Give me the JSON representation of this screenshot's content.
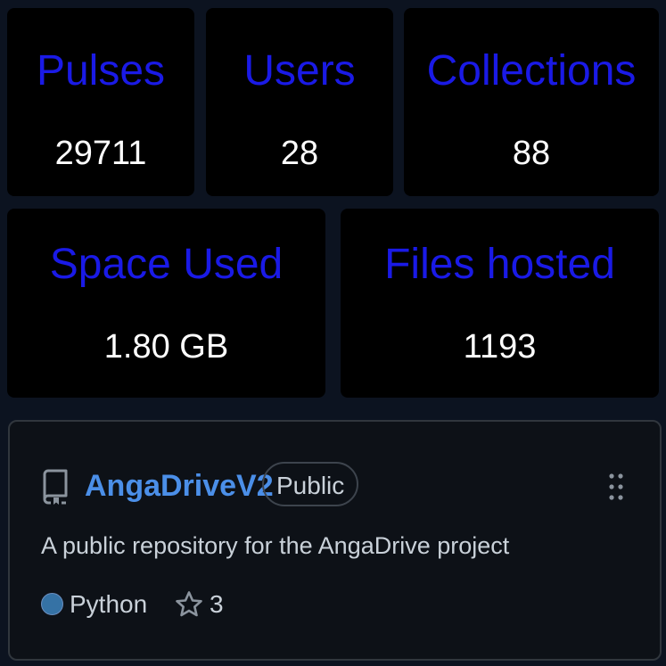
{
  "stats": {
    "pulses": {
      "label": "Pulses",
      "value": "29711"
    },
    "users": {
      "label": "Users",
      "value": "28"
    },
    "collections": {
      "label": "Collections",
      "value": "88"
    },
    "space_used": {
      "label": "Space Used",
      "value": "1.80 GB"
    },
    "files_hosted": {
      "label": "Files hosted",
      "value": "1193"
    }
  },
  "repo": {
    "name": "AngaDriveV2",
    "visibility": "Public",
    "description": "A public repository for the AngaDrive project",
    "language": "Python",
    "language_color": "#3572a5",
    "stars": "3",
    "icons": {
      "repo": "repo-icon",
      "menu": "kebab-menu-icon",
      "star": "star-icon"
    }
  },
  "colors": {
    "stat_label": "#1a1ae6",
    "stat_value": "#ffffff",
    "card_bg": "#000000",
    "page_bg": "#0c1320",
    "repo_link": "#4b8fe8"
  }
}
